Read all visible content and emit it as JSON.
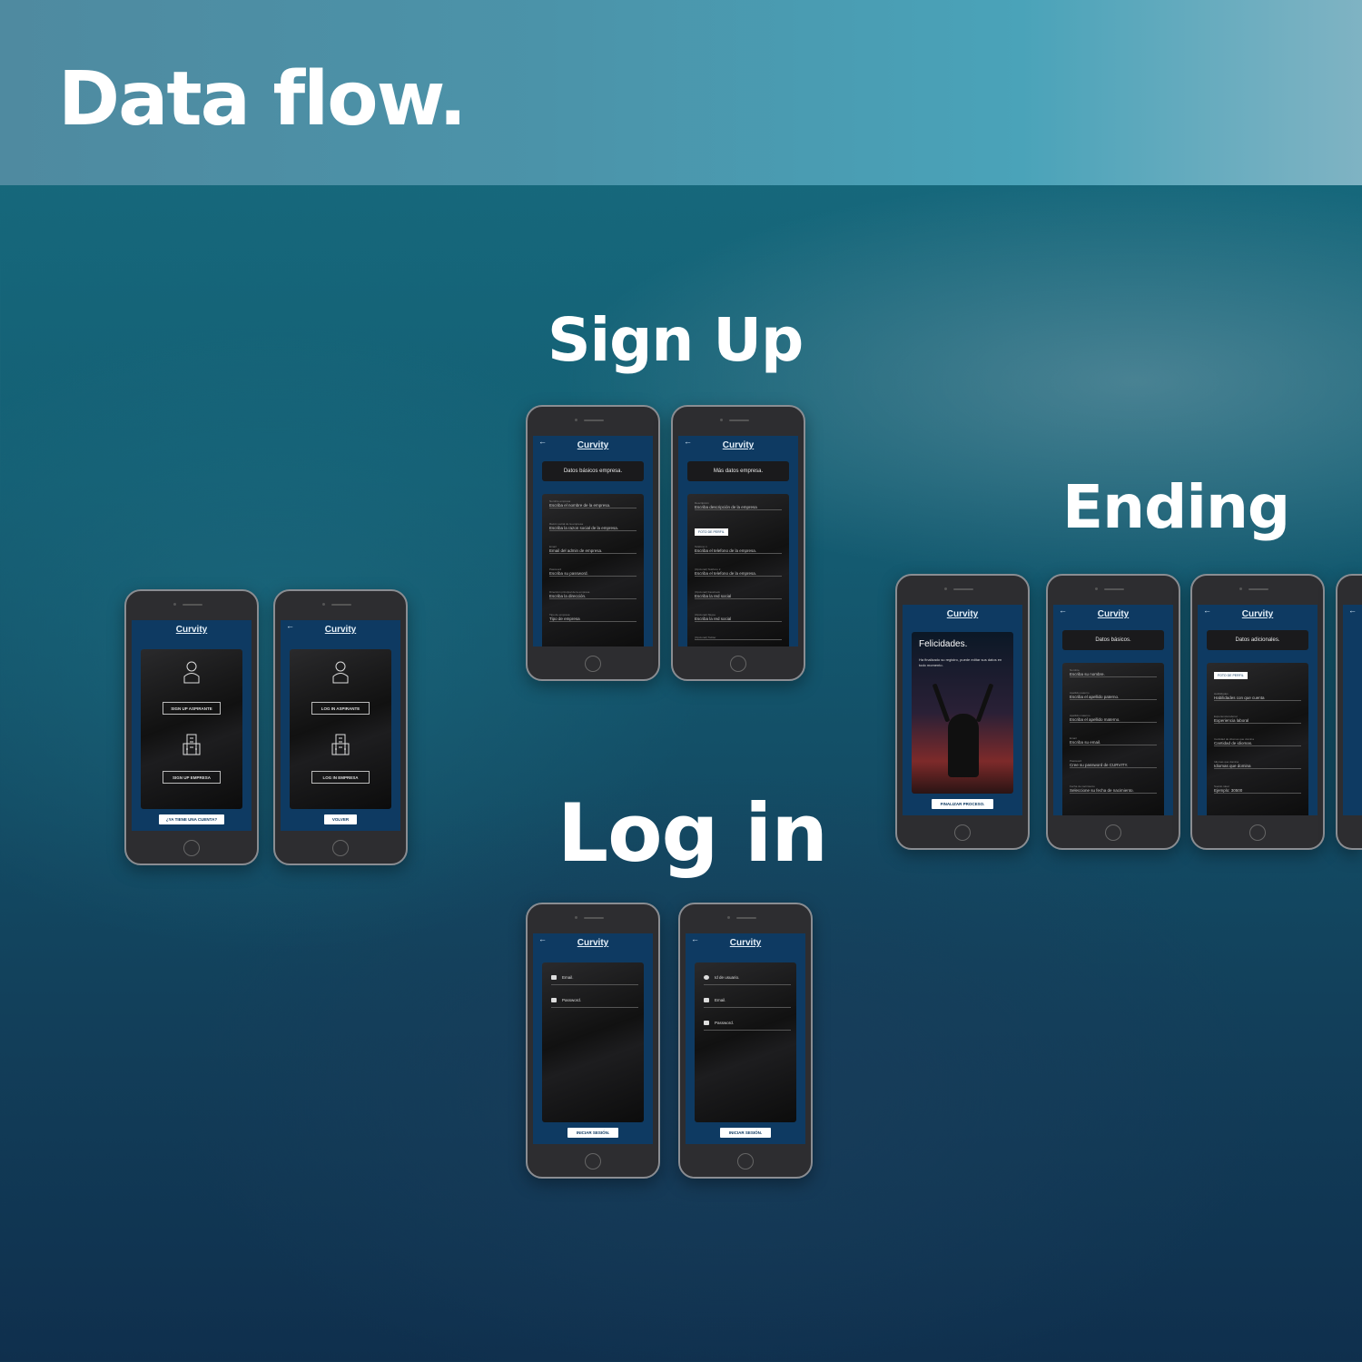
{
  "header": {
    "title": "Data flow."
  },
  "sections": {
    "signup": "Sign Up",
    "login": "Log in",
    "ending": "Ending"
  },
  "app": {
    "brand": "Curvity",
    "back_icon": "arrow-left-icon"
  },
  "welcome1": {
    "btn_signup_aspirante": "SIGN UP ASPIRANTE",
    "btn_signup_empresa": "SIGN UP EMPRESA",
    "btn_account": "¿YA TIENE UNA CUENTA?"
  },
  "welcome2": {
    "btn_login_aspirante": "LOG IN ASPIRANTE",
    "btn_login_empresa": "LOG IN EMPRESA",
    "btn_back": "VOLVER"
  },
  "signup1": {
    "title": "Datos básicos empresa.",
    "fields": [
      {
        "label": "Nombre empresa",
        "value": "Escriba el nombre de la empresa."
      },
      {
        "label": "Razón social de la empresa",
        "value": "Escriba la razon social de la empresa."
      },
      {
        "label": "Email",
        "value": "Email del admin de empresa."
      },
      {
        "label": "Password",
        "value": "Escriba su password."
      },
      {
        "label": "Dirección principal de la empresa",
        "value": "Escriba la dirección."
      },
      {
        "label": "Tipo de empresa",
        "value": "Tipo de empresa"
      }
    ]
  },
  "signup2": {
    "title": "Más datos empresa.",
    "photo_btn": "FOTO DE PERFIL",
    "fields": [
      {
        "label": "Descripción",
        "value": "Escriba descripción de la empresa"
      },
      {
        "label": "Teléfono 1",
        "value": "Escriba el telefono de la empresa."
      },
      {
        "label": "(Opcional) Teléfono 2",
        "value": "Escriba el telefono de la empresa."
      },
      {
        "label": "(Opcional) Facebook",
        "value": "Escriba la red social"
      },
      {
        "label": "(Opcional) Skype",
        "value": "Escriba la red social"
      },
      {
        "label": "(Opcional) Twitter",
        "value": ""
      }
    ]
  },
  "login1": {
    "email": "Email.",
    "password": "Password.",
    "submit": "INICIAR SESIÓN."
  },
  "login2": {
    "user_id": "Id de usuario.",
    "email": "Email.",
    "password": "Password.",
    "submit": "INICIAR SESIÓN."
  },
  "ending1": {
    "title": "Felicidades.",
    "text": "Ha finalizado su registro, puede editar sus datos en todo momento.",
    "btn": "FINALIZAR PROCESO."
  },
  "ending2": {
    "title": "Datos básicos.",
    "fields": [
      {
        "label": "Nombre",
        "value": "Escriba su nombre."
      },
      {
        "label": "Apellido paterno",
        "value": "Escriba el apellido paterno."
      },
      {
        "label": "Apellido materno",
        "value": "Escriba el apellido materno."
      },
      {
        "label": "Email",
        "value": "Escriba su email."
      },
      {
        "label": "Password",
        "value": "Cree su password de CURVITY."
      },
      {
        "label": "Fecha de nacimiento",
        "value": "Seleccione su fecha de nacimiento."
      }
    ]
  },
  "ending3": {
    "title": "Datos adicionales.",
    "photo_btn": "FOTO DE PERFIL",
    "fields": [
      {
        "label": "Habilidades",
        "value": "Habilidades con que cuenta"
      },
      {
        "label": "Experiencia laboral",
        "value": "Experiencia laboral"
      },
      {
        "label": "Cantidad de idiomas que domina",
        "value": "Cantidad de idiomas."
      },
      {
        "label": "Idiomas que domina",
        "value": "Idiomas que domina"
      },
      {
        "label": "Sueldo ideal",
        "value": "Ejemplo: 30500"
      }
    ]
  }
}
